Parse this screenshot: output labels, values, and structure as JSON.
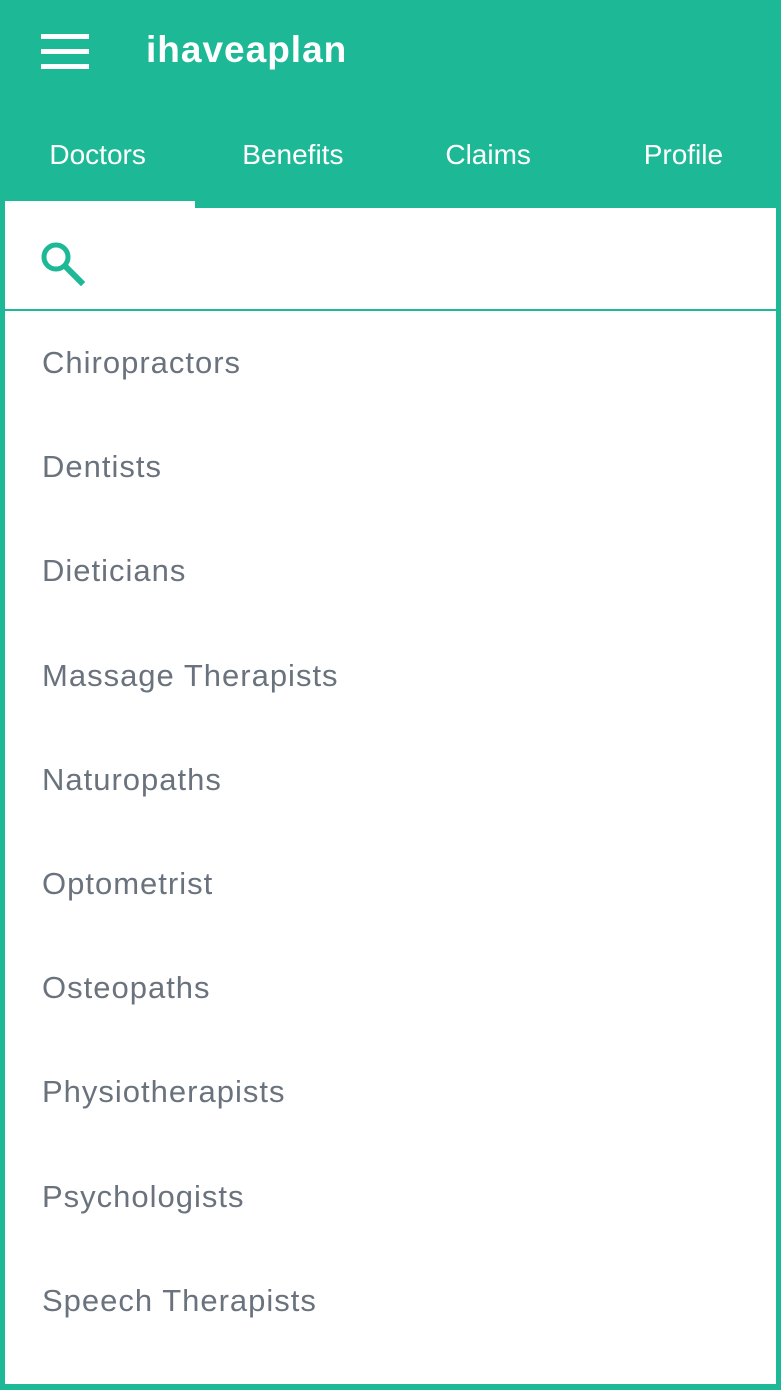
{
  "header": {
    "title": "ihaveaplan",
    "menu_icon": "hamburger-menu-icon"
  },
  "tabs": [
    {
      "label": "Doctors",
      "active": true
    },
    {
      "label": "Benefits",
      "active": false
    },
    {
      "label": "Claims",
      "active": false
    },
    {
      "label": "Profile",
      "active": false
    }
  ],
  "search": {
    "icon": "search-icon",
    "value": "",
    "placeholder": ""
  },
  "categories": [
    "Chiropractors",
    "Dentists",
    "Dieticians",
    "Massage Therapists",
    "Naturopaths",
    "Optometrist",
    "Osteopaths",
    "Physiotherapists",
    "Psychologists",
    "Speech Therapists"
  ],
  "colors": {
    "brand": "#1DB996",
    "text": "#6a737d",
    "surface": "#ffffff"
  }
}
